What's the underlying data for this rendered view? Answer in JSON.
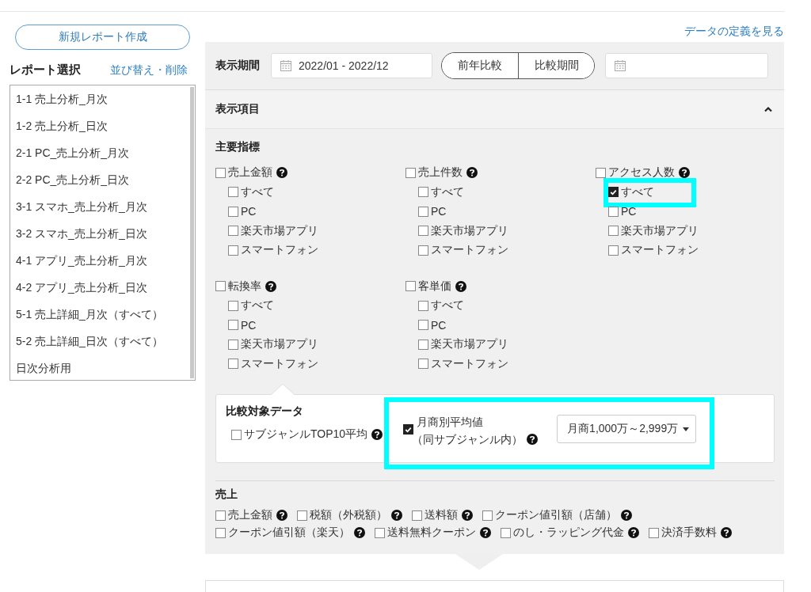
{
  "new_report_button": "新規レポート作成",
  "report_select": {
    "title": "レポート選択",
    "action_link": "並び替え・削除",
    "items": [
      {
        "label": "1-1 売上分析_月次"
      },
      {
        "label": "1-2 売上分析_日次"
      },
      {
        "label": "2-1 PC_売上分析_月次"
      },
      {
        "label": "2-2 PC_売上分析_日次"
      },
      {
        "label": "3-1 スマホ_売上分析_月次"
      },
      {
        "label": "3-2 スマホ_売上分析_日次"
      },
      {
        "label": "4-1 アプリ_売上分析_月次"
      },
      {
        "label": "4-2 アプリ_売上分析_日次"
      },
      {
        "label": "5-1 売上詳細_月次（すべて）"
      },
      {
        "label": "5-2 売上詳細_日次（すべて）"
      },
      {
        "label": "日次分析用"
      }
    ]
  },
  "definition_link": "データの定義を見る",
  "period": {
    "label": "表示期間",
    "date_range": "2022/01 - 2022/12",
    "compare_buttons": [
      "前年比較",
      "比較期間"
    ]
  },
  "display_items": {
    "title": "表示項目",
    "expanded": true
  },
  "main_metrics": {
    "title": "主要指標",
    "groups": [
      {
        "label": "売上金額",
        "checked": false,
        "children": [
          {
            "label": "すべて",
            "checked": false,
            "highlighted": false
          },
          {
            "label": "PC",
            "checked": false,
            "highlighted": false
          },
          {
            "label": "楽天市場アプリ",
            "checked": false,
            "highlighted": false
          },
          {
            "label": "スマートフォン",
            "checked": false,
            "highlighted": false
          }
        ]
      },
      {
        "label": "売上件数",
        "checked": false,
        "children": [
          {
            "label": "すべて",
            "checked": false,
            "highlighted": false
          },
          {
            "label": "PC",
            "checked": false,
            "highlighted": false
          },
          {
            "label": "楽天市場アプリ",
            "checked": false,
            "highlighted": false
          },
          {
            "label": "スマートフォン",
            "checked": false,
            "highlighted": false
          }
        ]
      },
      {
        "label": "アクセス人数",
        "checked": false,
        "children": [
          {
            "label": "すべて",
            "checked": true,
            "highlighted": true
          },
          {
            "label": "PC",
            "checked": false,
            "highlighted": false
          },
          {
            "label": "楽天市場アプリ",
            "checked": false,
            "highlighted": false
          },
          {
            "label": "スマートフォン",
            "checked": false,
            "highlighted": false
          }
        ]
      },
      {
        "label": "転換率",
        "checked": false,
        "children": [
          {
            "label": "すべて",
            "checked": false,
            "highlighted": false
          },
          {
            "label": "PC",
            "checked": false,
            "highlighted": false
          },
          {
            "label": "楽天市場アプリ",
            "checked": false,
            "highlighted": false
          },
          {
            "label": "スマートフォン",
            "checked": false,
            "highlighted": false
          }
        ]
      },
      {
        "label": "客単価",
        "checked": false,
        "children": [
          {
            "label": "すべて",
            "checked": false,
            "highlighted": false
          },
          {
            "label": "PC",
            "checked": false,
            "highlighted": false
          },
          {
            "label": "楽天市場アプリ",
            "checked": false,
            "highlighted": false
          },
          {
            "label": "スマートフォン",
            "checked": false,
            "highlighted": false
          }
        ]
      }
    ]
  },
  "comparison": {
    "title": "比較対象データ",
    "items": [
      {
        "kind": "plain",
        "label": "サブジャンルTOP10平均",
        "checked": false,
        "highlighted": false
      },
      {
        "kind": "dropdown",
        "label": "月商別平均値",
        "sublabel": "（同サブジャンル内）",
        "checked": true,
        "highlighted": true,
        "value": "月商1,000万～2,999万"
      }
    ]
  },
  "sales": {
    "title": "売上",
    "items": [
      {
        "label": "売上金額",
        "checked": false
      },
      {
        "label": "税額（外税額）",
        "checked": false
      },
      {
        "label": "送料額",
        "checked": false
      },
      {
        "label": "クーポン値引額（店舗）",
        "checked": false
      },
      {
        "label": "クーポン値引額（楽天）",
        "checked": false
      },
      {
        "label": "送料無料クーポン",
        "checked": false
      },
      {
        "label": "のし・ラッピング代金",
        "checked": false
      },
      {
        "label": "決済手数料",
        "checked": false
      }
    ]
  }
}
